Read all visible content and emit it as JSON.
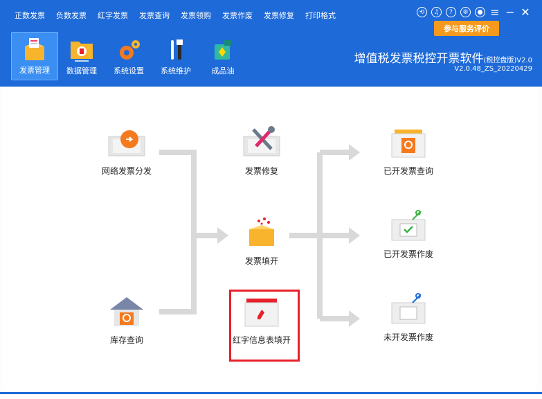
{
  "menu": [
    "正数发票",
    "负数发票",
    "红字发票",
    "发票查询",
    "发票领购",
    "发票作废",
    "发票修复",
    "打印格式"
  ],
  "window_controls": {
    "icons": [
      "refresh-icon",
      "headset-icon",
      "help-icon",
      "settings-icon",
      "user-icon",
      "menu-icon",
      "minimize-icon",
      "close-icon"
    ],
    "review_label": "参与服务评价"
  },
  "toolbar": [
    {
      "label": "发票管理",
      "icon": "invoice-management-icon",
      "active": true
    },
    {
      "label": "数据管理",
      "icon": "data-management-icon",
      "active": false
    },
    {
      "label": "系统设置",
      "icon": "system-settings-icon",
      "active": false
    },
    {
      "label": "系统维护",
      "icon": "system-maintenance-icon",
      "active": false
    },
    {
      "label": "成品油",
      "icon": "refined-oil-icon",
      "active": false
    }
  ],
  "app": {
    "title": "增值税发票税控开票软件",
    "title_suffix": "(税控盘版)V2.0",
    "version": "V2.0.48_ZS_20220429"
  },
  "flow": {
    "network_distribute": "网络发票分发",
    "repair": "发票修复",
    "issue": "发票填开",
    "inventory": "库存查询",
    "red_info": "红字信息表填开",
    "issued_query": "已开发票查询",
    "issued_void": "已开发票作废",
    "unissued_void": "未开发票作废"
  },
  "colors": {
    "header": "#1e6ad8",
    "accent": "#f59a1e",
    "highlight": "#e8202a",
    "arrow": "#d9d9d9"
  }
}
